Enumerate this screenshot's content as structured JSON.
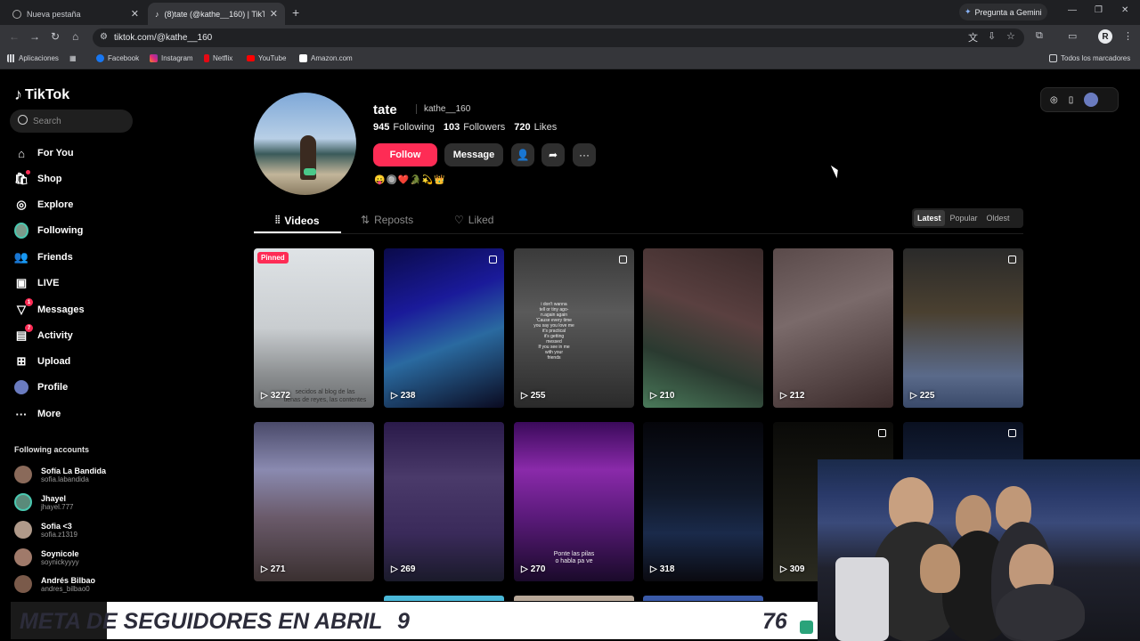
{
  "browser": {
    "tabs": [
      {
        "title": "Nueva pestaña",
        "active": false
      },
      {
        "title": "(8)tate (@kathe__160) | TikTok",
        "active": true
      }
    ],
    "gemini_label": "Pregunta a Gemini",
    "url": "tiktok.com/@kathe__160",
    "profile_initial": "R",
    "bookmarks": [
      "Aplicaciones",
      "Facebook",
      "Instagram",
      "Netflix",
      "YouTube",
      "Amazon.com"
    ],
    "all_bookmarks": "Todos los marcadores"
  },
  "sidebar": {
    "logo": "TikTok",
    "search_placeholder": "Search",
    "nav": [
      {
        "label": "For You",
        "icon": "home-icon"
      },
      {
        "label": "Shop",
        "icon": "shop-icon"
      },
      {
        "label": "Explore",
        "icon": "compass-icon"
      },
      {
        "label": "Following",
        "icon": "following-avatar"
      },
      {
        "label": "Friends",
        "icon": "friends-icon"
      },
      {
        "label": "LIVE",
        "icon": "live-icon"
      },
      {
        "label": "Messages",
        "icon": "messages-icon",
        "badge": "1"
      },
      {
        "label": "Activity",
        "icon": "activity-icon",
        "badge": "7"
      },
      {
        "label": "Upload",
        "icon": "upload-icon"
      },
      {
        "label": "Profile",
        "icon": "profile-avatar"
      },
      {
        "label": "More",
        "icon": "more-icon"
      }
    ],
    "following_title": "Following accounts",
    "following": [
      {
        "name": "Sofía La Bandida",
        "handle": "sofia.labandida",
        "color": "#8a6a5a"
      },
      {
        "name": "Jhayel",
        "handle": "jhayel.777",
        "color": "#5a8a7a"
      },
      {
        "name": "Sofia <3",
        "handle": "sofia.z1319",
        "color": "#b09a8a"
      },
      {
        "name": "Soynicole",
        "handle": "soynickyyyy",
        "color": "#a07a6a"
      },
      {
        "name": "Andrés Bilbao",
        "handle": "andres_bilbao0",
        "color": "#7a5a4a"
      }
    ]
  },
  "profile": {
    "name": "tate",
    "handle": "kathe__160",
    "following_count": "945",
    "following_label": "Following",
    "followers_count": "103",
    "followers_label": "Followers",
    "likes_count": "720",
    "likes_label": "Likes",
    "follow_label": "Follow",
    "message_label": "Message",
    "bio": "😛🔘❤️🐊💫👑"
  },
  "tabs": {
    "videos": "Videos",
    "reposts": "Reposts",
    "liked": "Liked"
  },
  "sort": {
    "latest": "Latest",
    "popular": "Popular",
    "oldest": "Oldest"
  },
  "videos": [
    {
      "views": "3272",
      "pinned": "Pinned",
      "multi": false,
      "bg": "linear-gradient(180deg,#dfe3e6 0%,#c9cdd0 50%,#8a8d8f 80%,#6a6c6e 100%)",
      "caption": "secidos al blog de las\ntienas de reyes, las contentes"
    },
    {
      "views": "238",
      "multi": true,
      "bg": "linear-gradient(160deg,#0a0a4a 0%,#1a1a9a 35%,#2a6aa0 60%,#0a0a20 100%)"
    },
    {
      "views": "255",
      "multi": true,
      "bg": "linear-gradient(180deg,#3a3a3a 0%,#5a5a5a 40%,#2a2a2a 100%)",
      "caption": "i don't wanna\ntell or tiny ago-\nn.again again\n'Cause every time\nyou say you love me\nit's practical\nit's getting\nmessed\nIf you see in me\nwith your\nfriends"
    },
    {
      "views": "210",
      "multi": false,
      "bg": "linear-gradient(200deg,#3a2a2a 0%,#5a4040 40%,#2a3a30 70%,#4a7a5a 100%)"
    },
    {
      "views": "212",
      "multi": false,
      "bg": "linear-gradient(160deg,#5a4a4a 0%,#7a6a6a 40%,#3a2a2a 100%)"
    },
    {
      "views": "225",
      "multi": true,
      "bg": "linear-gradient(180deg,#2a2a2a 0%,#4a4030 40%,#5a6a8a 80%,#3a4a6a 100%)"
    },
    {
      "views": "271",
      "multi": false,
      "bg": "linear-gradient(180deg,#4a4a6a 0%,#8a8ab0 30%,#6a5a6a 60%,#3a3030 100%)"
    },
    {
      "views": "269",
      "multi": false,
      "bg": "linear-gradient(180deg,#2a1a4a 0%,#4a3a6a 35%,#3a2a5a 70%,#1a1a2a 100%)"
    },
    {
      "views": "270",
      "multi": false,
      "bg": "linear-gradient(180deg,#3a0a5a 0%,#8a2aaa 30%,#5a1a7a 60%,#1a0a2a 100%)",
      "caption": "Ponte las pilas\no habla pa ve"
    },
    {
      "views": "318",
      "multi": false,
      "bg": "linear-gradient(180deg,#05050a 0%,#101828 45%,#1a2a4a 70%,#0a0a10 100%)"
    },
    {
      "views": "309",
      "multi": true,
      "bg": "linear-gradient(180deg,#0a0a08 0%,#1a1a14 50%,#2a2a20 100%)"
    },
    {
      "views": "",
      "multi": true,
      "bg": "linear-gradient(180deg,#0a1020 0%,#1a2a4a 50%,#0a0a1a 100%)"
    }
  ],
  "stream_overlay": {
    "banner_text": "META DE SEGUIDORES EN ABRIL",
    "current": "9",
    "goal": "76"
  },
  "colors": {
    "accent": "#fe2c55",
    "background": "#000000"
  }
}
